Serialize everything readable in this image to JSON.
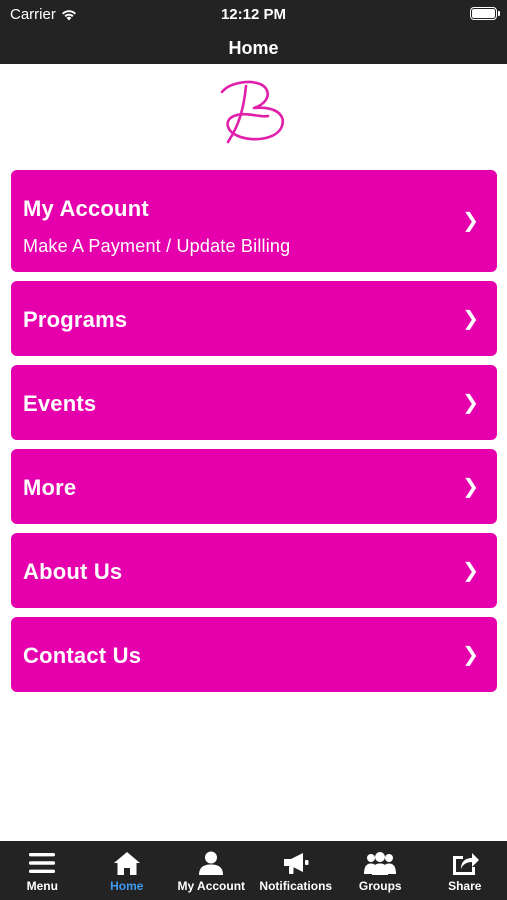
{
  "status_bar": {
    "carrier": "Carrier",
    "time": "12:12 PM"
  },
  "nav": {
    "title": "Home"
  },
  "logo": {
    "icon": "script-b-logo-icon",
    "color": "#e01faa"
  },
  "menu": {
    "accent": "#e600ad",
    "items": [
      {
        "title": "My Account",
        "subtitle": "Make A Payment / Update Billing",
        "chevron": "❯"
      },
      {
        "title": "Programs",
        "chevron": "❯"
      },
      {
        "title": "Events",
        "chevron": "❯"
      },
      {
        "title": "More",
        "chevron": "❯"
      },
      {
        "title": "About Us",
        "chevron": "❯"
      },
      {
        "title": "Contact Us",
        "chevron": "❯"
      }
    ]
  },
  "tabbar": {
    "active_color": "#3d9bf0",
    "tabs": [
      {
        "label": "Menu",
        "icon": "hamburger-menu-icon"
      },
      {
        "label": "Home",
        "icon": "home-icon",
        "active": true
      },
      {
        "label": "My Account",
        "icon": "user-icon"
      },
      {
        "label": "Notifications",
        "icon": "megaphone-icon"
      },
      {
        "label": "Groups",
        "icon": "group-icon"
      },
      {
        "label": "Share",
        "icon": "share-icon"
      }
    ]
  }
}
